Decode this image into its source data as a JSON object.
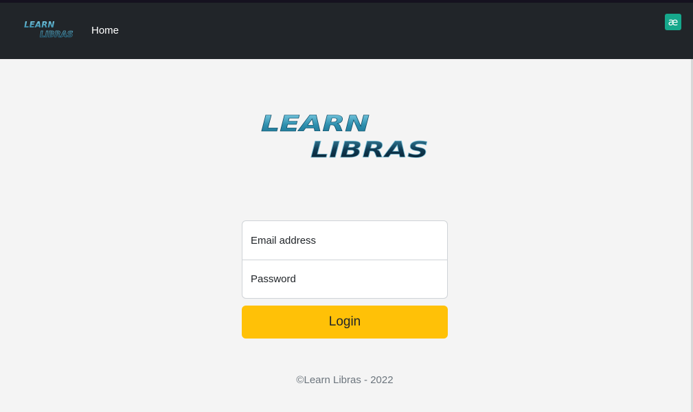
{
  "navbar": {
    "brand_top": "LEARN",
    "brand_bottom": "LIBRAS",
    "home_label": "Home",
    "extension_icon": "ae-ligature-icon",
    "extension_glyph": "æ"
  },
  "logo": {
    "line1": "LEARN",
    "line2": "LIBRAS"
  },
  "form": {
    "email_label": "Email address",
    "password_label": "Password",
    "submit_label": "Login"
  },
  "footer": {
    "copyright": "©Learn Libras - 2022"
  },
  "colors": {
    "navbar_bg": "#212529",
    "page_bg": "#f4f4f4",
    "button_bg": "#ffc107",
    "logo_light": "#2e8fae",
    "logo_dark": "#0a2638",
    "extension_bg": "#16a88c"
  }
}
